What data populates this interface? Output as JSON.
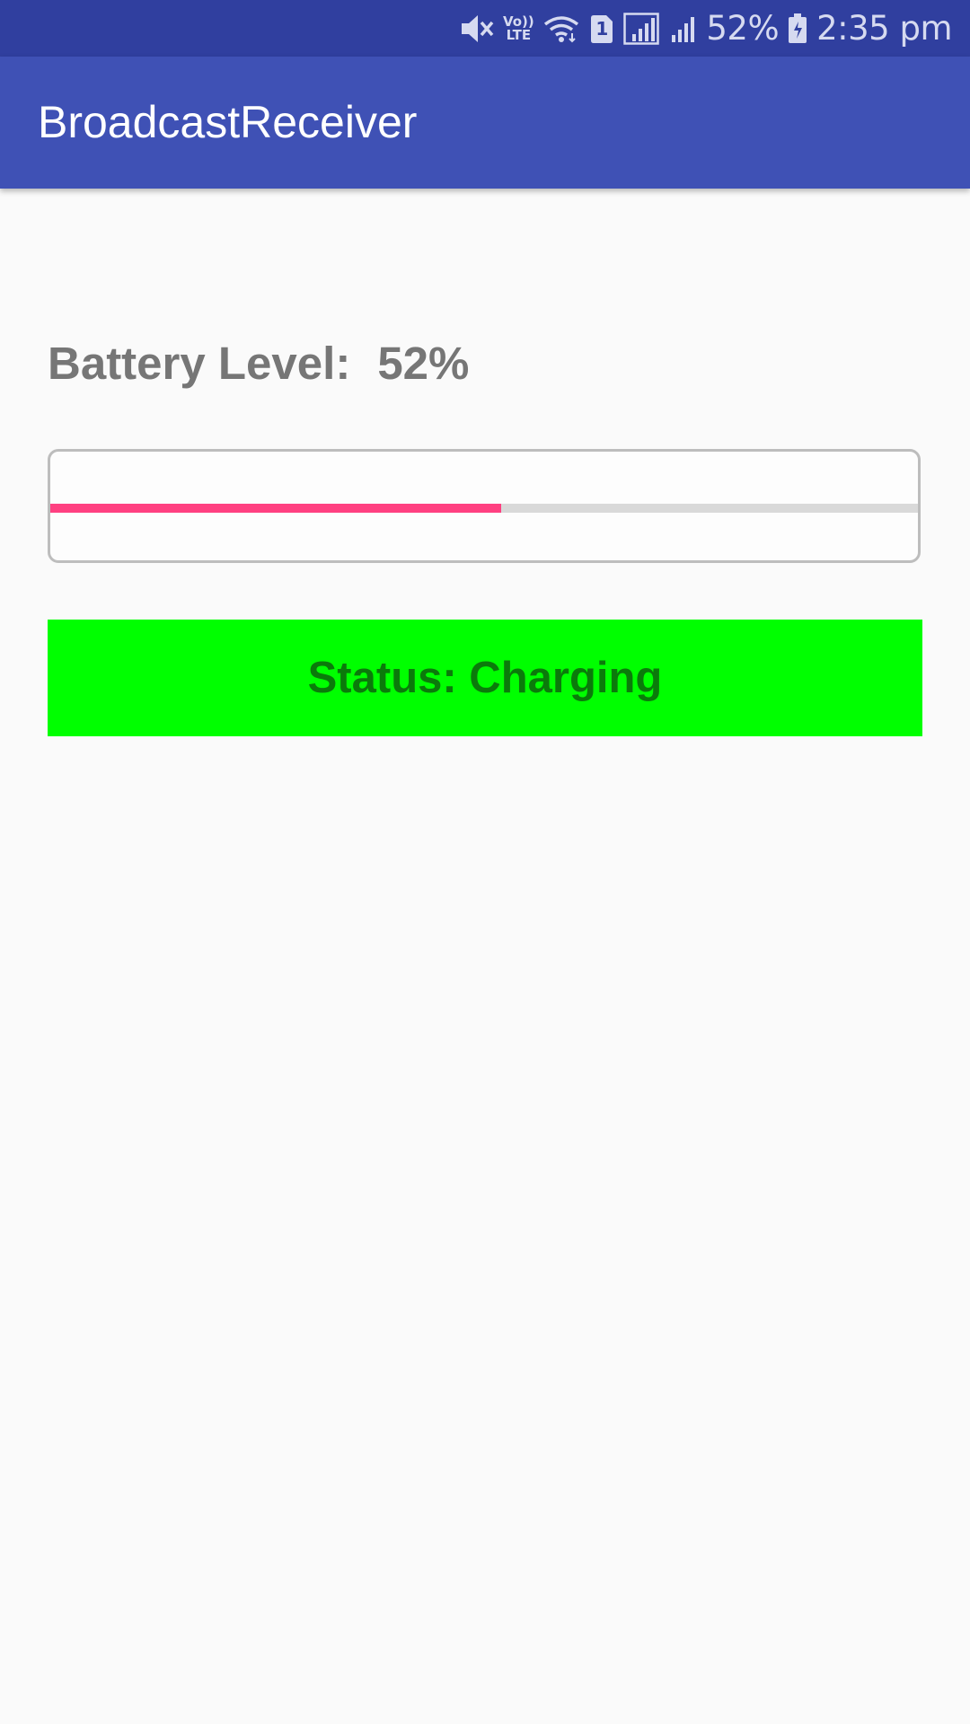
{
  "status_bar": {
    "network_label_top": "Vo))",
    "network_label_bottom": "LTE",
    "sim_badge": "1",
    "battery_percent": "52%",
    "time": "2:35 pm",
    "icons": [
      "mute-icon",
      "volte-icon",
      "wifi-icon",
      "sim-1-icon",
      "signal-roaming-icon",
      "signal-icon",
      "battery-charging-icon"
    ]
  },
  "app_bar": {
    "title": "BroadcastReceiver",
    "color": "#3f51b5"
  },
  "battery": {
    "label": "Battery Level:",
    "value": "52%",
    "level_fraction": 0.52
  },
  "progress": {
    "fill_color": "#ff4081",
    "track_color": "#d9d9d9"
  },
  "status": {
    "text": "Status: Charging",
    "background": "#00ff00"
  }
}
